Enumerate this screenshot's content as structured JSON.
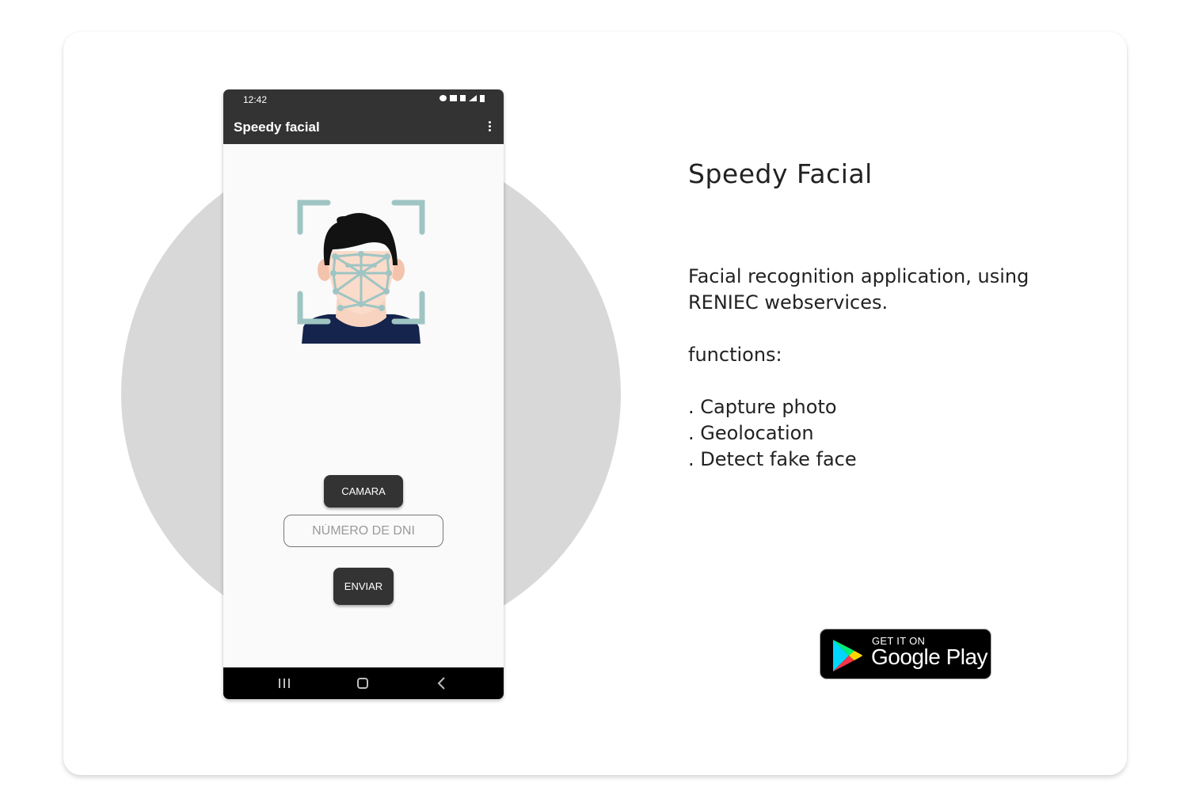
{
  "phone": {
    "status_time": "12:42",
    "app_title": "Speedy facial",
    "camera_button": "CAMARA",
    "dni_placeholder": "NÚMERO DE DNI",
    "send_button": "ENVIAR",
    "icons": {
      "menu": "more-vert-icon",
      "nav_recent": "recent-apps-icon",
      "nav_home": "home-icon",
      "nav_back": "back-icon"
    }
  },
  "headline": "Speedy Facial",
  "description": {
    "intro_line1": "Facial recognition application, using",
    "intro_line2": "RENIEC webservices.",
    "functions_label": "functions:",
    "features": [
      ". Capture photo",
      ". Geolocation",
      ". Detect fake face"
    ]
  },
  "store_badge": {
    "small_text": "GET IT ON",
    "big_text": "Google Play"
  },
  "colors": {
    "phone_bar": "#333333",
    "circle_bg": "#d8d8d8",
    "face_frame": "#9fc5c3"
  }
}
